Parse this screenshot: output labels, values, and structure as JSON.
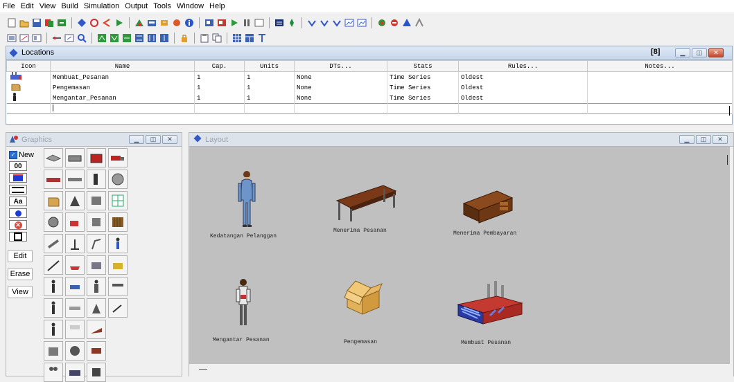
{
  "menu": [
    "File",
    "Edit",
    "View",
    "Build",
    "Simulation",
    "Output",
    "Tools",
    "Window",
    "Help"
  ],
  "locations": {
    "title": "Locations",
    "badge": "[8]",
    "columns": [
      "Icon",
      "Name",
      "Cap.",
      "Units",
      "DTs...",
      "Stats",
      "Rules...",
      "Notes..."
    ],
    "rows": [
      {
        "name": "Membuat_Pesanan",
        "cap": "1",
        "units": "1",
        "dts": "None",
        "stats": "Time Series",
        "rules": "Oldest",
        "notes": ""
      },
      {
        "name": "Pengemasan",
        "cap": "1",
        "units": "1",
        "dts": "None",
        "stats": "Time Series",
        "rules": "Oldest",
        "notes": ""
      },
      {
        "name": "Mengantar_Pesanan",
        "cap": "1",
        "units": "1",
        "dts": "None",
        "stats": "Time Series",
        "rules": "Oldest",
        "notes": ""
      }
    ]
  },
  "graphics": {
    "title": "Graphics",
    "new_label": "New",
    "counter": "00",
    "aa_label": "Aa",
    "edit_label": "Edit",
    "erase_label": "Erase",
    "view_label": "View"
  },
  "layout": {
    "title": "Layout",
    "labels": {
      "kedatangan": "Kedatangan Pelanggan",
      "menerima_pesanan": "Menerima Pesanan",
      "menerima_pembayaran": "Menerima Pembayaran",
      "mengantar": "Mengantar Pesanan",
      "pengemasan": "Pengemasan",
      "membuat": "Membuat Pesanan"
    }
  }
}
